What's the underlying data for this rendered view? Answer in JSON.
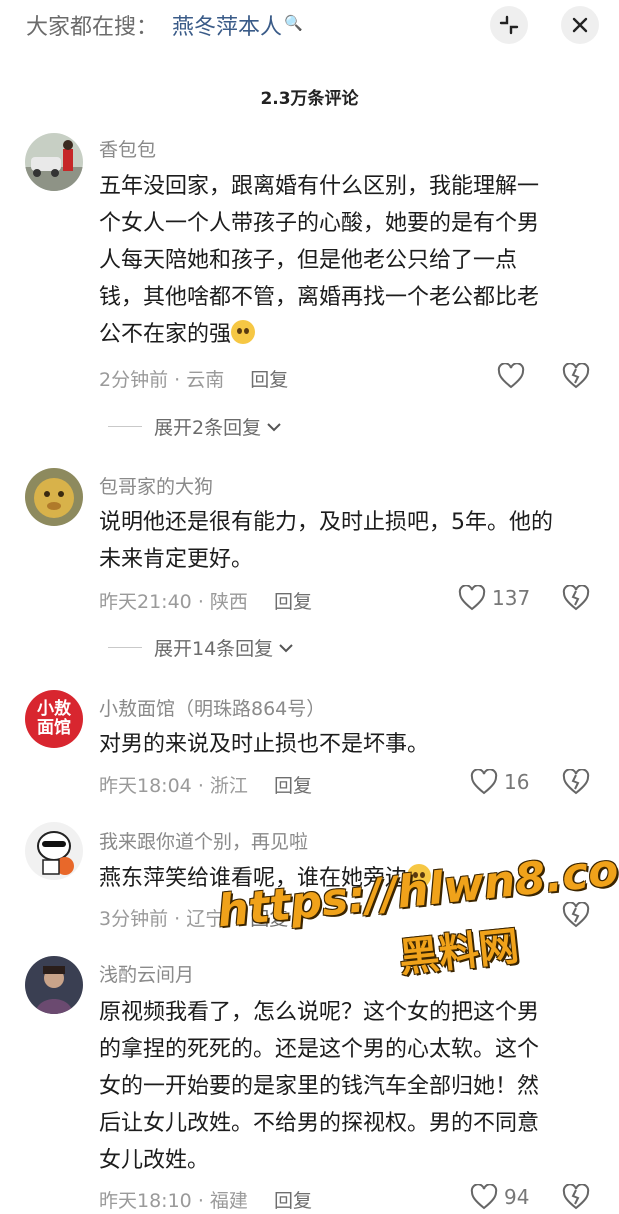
{
  "search": {
    "prefix": "大家都在搜：",
    "query": "燕冬萍本人",
    "search_glyph": "🔍",
    "icons": [
      "collapse-icon",
      "close-icon"
    ]
  },
  "comments_count": "2.3万条评论",
  "comments": [
    {
      "name": "香包包",
      "lines": [
        "五年没回家，跟离婚有什么区别，我能理解一",
        "个女人一个人带孩子的心酸，她要的是有个男",
        "人每天陪她和孩子，但是他老公只给了一点",
        "钱，其他啥都不管，离婚再找一个老公都比老",
        "公不在家的强"
      ],
      "time": "2分钟前",
      "location": "云南",
      "reply": "回复",
      "likes": "",
      "expand": "展开2条回复"
    },
    {
      "name": "包哥家的大狗",
      "lines": [
        "说明他还是很有能力，及时止损吧，5年。他的",
        "未来肯定更好。"
      ],
      "time": "昨天21:40",
      "location": "陕西",
      "reply": "回复",
      "likes": "137",
      "expand": "展开14条回复"
    },
    {
      "name": "小敖面馆（明珠路864号）",
      "avatar_text": "小敖面馆",
      "lines": [
        "对男的来说及时止损也不是坏事。"
      ],
      "time": "昨天18:04",
      "location": "浙江",
      "reply": "回复",
      "likes": "16"
    },
    {
      "name": "我来跟你道个别，再见啦",
      "lines": [
        "燕东萍笑给谁看呢，谁在她旁边"
      ],
      "time": "3分钟前",
      "location": "辽宁",
      "reply": "回复",
      "likes": ""
    },
    {
      "name": "浅酌云间月",
      "lines": [
        "原视频我看了，怎么说呢？这个女的把这个男",
        "的拿捏的死死的。还是这个男的心太软。这个",
        "女的一开始要的是家里的钱汽车全部归她！然",
        "后让女儿改姓。不给男的探视权。男的不同意",
        "女儿改姓。"
      ],
      "time": "昨天18:10",
      "location": "福建",
      "reply": "回复",
      "likes": "94"
    }
  ],
  "meta_separator": "·",
  "watermark": {
    "line1": "https://hlwn8.com",
    "line2": "黑料网"
  },
  "colors": {
    "link": "#3a5b88",
    "watermark": "#f0a21a"
  }
}
